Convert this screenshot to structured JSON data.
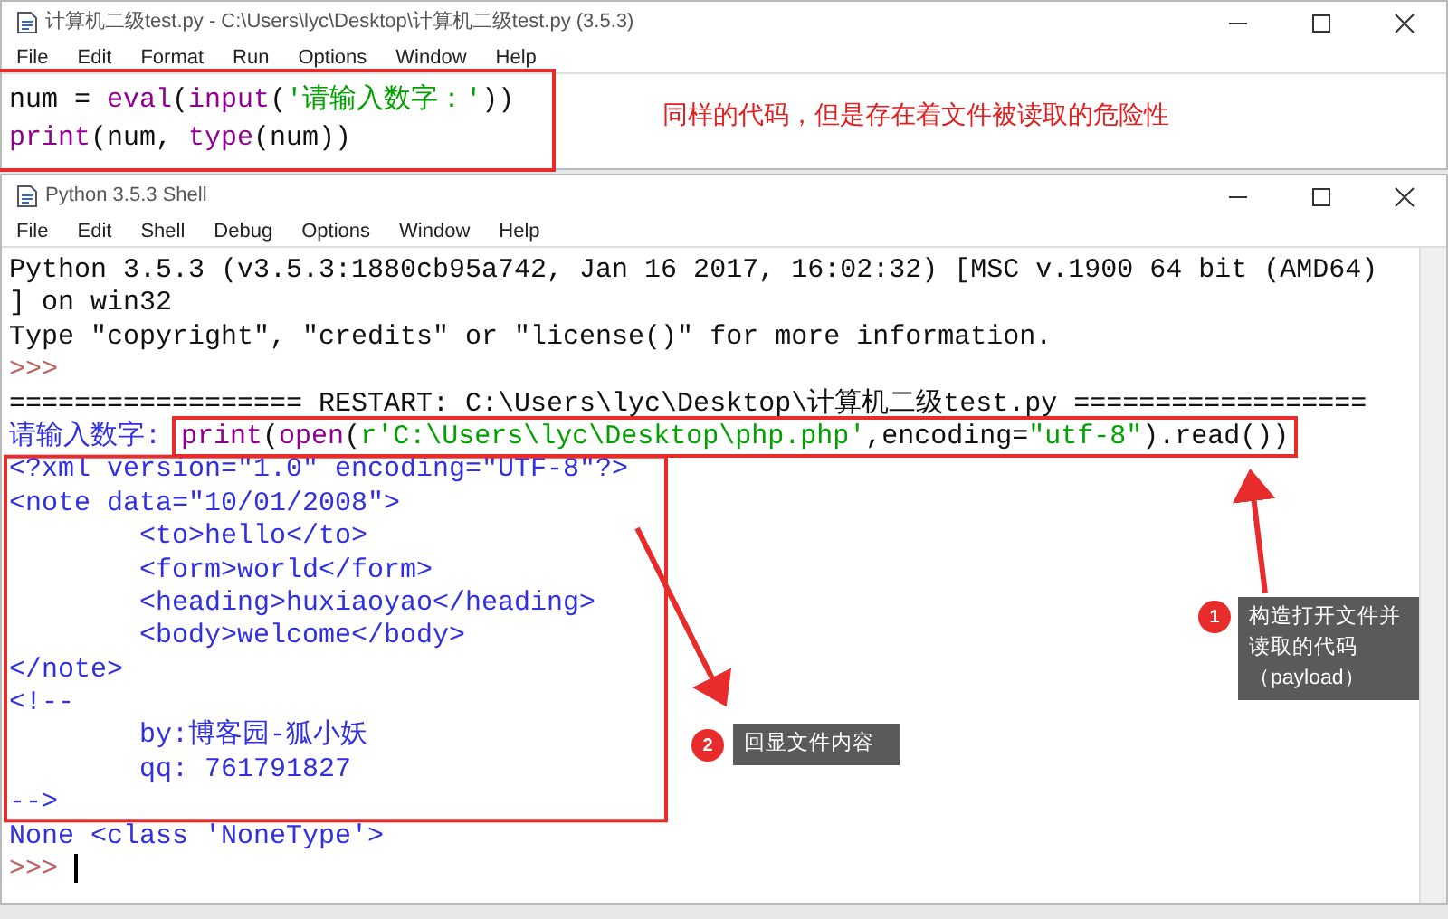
{
  "editor_window": {
    "title": "计算机二级test.py - C:\\Users\\lyc\\Desktop\\计算机二级test.py (3.5.3)",
    "menu": [
      "File",
      "Edit",
      "Format",
      "Run",
      "Options",
      "Window",
      "Help"
    ],
    "code_lines": [
      [
        {
          "kind": "plain",
          "text": "num = "
        },
        {
          "kind": "builtin",
          "text": "eval"
        },
        {
          "kind": "plain",
          "text": "("
        },
        {
          "kind": "builtin",
          "text": "input"
        },
        {
          "kind": "plain",
          "text": "("
        },
        {
          "kind": "string",
          "text": "'请输入数字：'"
        },
        {
          "kind": "plain",
          "text": "))"
        }
      ],
      [
        {
          "kind": "builtin",
          "text": "print"
        },
        {
          "kind": "plain",
          "text": "(num, "
        },
        {
          "kind": "builtin",
          "text": "type"
        },
        {
          "kind": "plain",
          "text": "(num))"
        }
      ]
    ],
    "note": "同样的代码，但是存在着文件被读取的危险性"
  },
  "shell_window": {
    "title": "Python 3.5.3 Shell",
    "menu": [
      "File",
      "Edit",
      "Shell",
      "Debug",
      "Options",
      "Window",
      "Help"
    ],
    "lines": [
      [
        {
          "kind": "plain",
          "text": "Python 3.5.3 (v3.5.3:1880cb95a742, Jan 16 2017, 16:02:32) [MSC v.1900 64 bit (AMD64)"
        }
      ],
      [
        {
          "kind": "plain",
          "text": "] on win32"
        }
      ],
      [
        {
          "kind": "plain",
          "text": "Type \"copyright\", \"credits\" or \"license()\" for more information."
        }
      ],
      [
        {
          "kind": "prompt",
          "text": ">>>"
        }
      ],
      [
        {
          "kind": "plain",
          "text": "================== RESTART: C:\\Users\\lyc\\Desktop\\计算机二级test.py =================="
        }
      ],
      [
        {
          "kind": "stdout",
          "text": "请输入数字: "
        },
        {
          "kind": "builtin",
          "text": "print"
        },
        {
          "kind": "plain",
          "text": "("
        },
        {
          "kind": "builtin",
          "text": "open"
        },
        {
          "kind": "plain",
          "text": "("
        },
        {
          "kind": "string",
          "text": "r'C:\\Users\\lyc\\Desktop\\php.php'"
        },
        {
          "kind": "plain",
          "text": ",encoding="
        },
        {
          "kind": "string",
          "text": "\"utf-8\""
        },
        {
          "kind": "plain",
          "text": ").read())"
        }
      ],
      [
        {
          "kind": "stdout",
          "text": "<?xml version=\"1.0\" encoding=\"UTF-8\"?>"
        }
      ],
      [
        {
          "kind": "stdout",
          "text": "<note data=\"10/01/2008\">"
        }
      ],
      [
        {
          "kind": "stdout",
          "text": "        <to>hello</to>"
        }
      ],
      [
        {
          "kind": "stdout",
          "text": "        <form>world</form>"
        }
      ],
      [
        {
          "kind": "stdout",
          "text": "        <heading>huxiaoyao</heading>"
        }
      ],
      [
        {
          "kind": "stdout",
          "text": "        <body>welcome</body>"
        }
      ],
      [
        {
          "kind": "stdout",
          "text": "</note>"
        }
      ],
      [
        {
          "kind": "stdout",
          "text": "<!--"
        }
      ],
      [
        {
          "kind": "stdout",
          "text": "        by:博客园-狐小妖"
        }
      ],
      [
        {
          "kind": "stdout",
          "text": "        qq: 761791827"
        }
      ],
      [
        {
          "kind": "stdout",
          "text": "-->"
        }
      ],
      [
        {
          "kind": "stdout",
          "text": "None <class 'NoneType'>"
        }
      ],
      [
        {
          "kind": "prompt",
          "text": ">>>"
        }
      ]
    ]
  },
  "callouts": [
    {
      "number": "1",
      "text": "构造打开文件并读取的代码（payload）"
    },
    {
      "number": "2",
      "text": "回显文件内容"
    }
  ]
}
